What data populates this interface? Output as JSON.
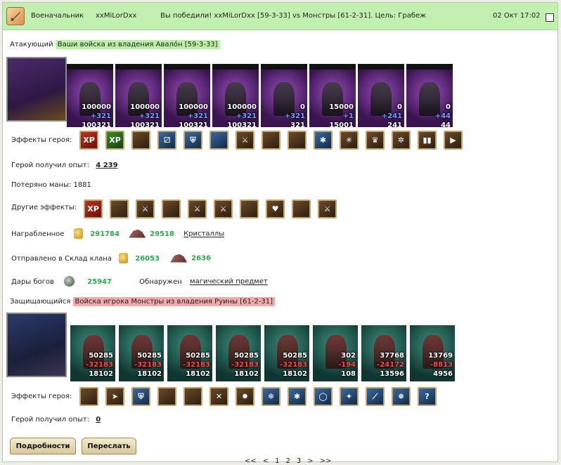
{
  "header": {
    "role": "Военачальник",
    "player": "xxMiLorDxx",
    "message": "Вы победили! xxMiLorDxx [59-3-33] vs Монстры [61-2-31]. Цель: Грабеж",
    "date": "02 Окт 17:02"
  },
  "attacker": {
    "label": "Атакующий",
    "army": "Ваши войска из владения Авалóн [59-3-33]",
    "units": [
      {
        "n1": "100000",
        "n2": "+321",
        "n3": "100321"
      },
      {
        "n1": "100000",
        "n2": "+321",
        "n3": "100321"
      },
      {
        "n1": "100000",
        "n2": "+321",
        "n3": "100321"
      },
      {
        "n1": "100000",
        "n2": "+321",
        "n3": "100321"
      },
      {
        "n1": "0",
        "n2": "+321",
        "n3": "321"
      },
      {
        "n1": "15000",
        "n2": "+1",
        "n3": "15001"
      },
      {
        "n1": "0",
        "n2": "+241",
        "n3": "241"
      },
      {
        "n1": "0",
        "n2": "+44",
        "n3": "44"
      }
    ]
  },
  "hero_effects_label": "Эффекты героя:",
  "attacker_hero_effects_icons": [
    "xp-icon",
    "xp-scroll-icon",
    "tome-icon",
    "dice-icon",
    "shield-icon",
    "hand-shield-icon",
    "sword-icon",
    "handshake-icon",
    "hand-icon",
    "ice-icon",
    "web-icon",
    "gold-idol-icon",
    "spider-icon",
    "boots-icon",
    "arrow-right-icon"
  ],
  "xp_gained": {
    "label": "Герой получил опыт:",
    "value": "4 239"
  },
  "mana_lost": "Потеряно маны: 1881",
  "other_effects": {
    "label": "Другие эффекты:",
    "icons": [
      "xp-icon",
      "scroll-icon",
      "sword-icon",
      "scroll-icon",
      "sword-icon",
      "sword-icon",
      "scroll-icon",
      "heart-icon",
      "scroll-icon",
      "sword-icon"
    ]
  },
  "plunder": {
    "label": "Награбленное",
    "gold": "291784",
    "crystals": "29518",
    "crystals_link": "Кристаллы"
  },
  "clan": {
    "label": "Отправлено в Склад клана",
    "gold": "26053",
    "crystals": "2636"
  },
  "gifts": {
    "label": "Дары богов",
    "value": "25947",
    "found_label": "Обнаружен",
    "found_link": "магический предмет"
  },
  "defender": {
    "label": "Защищающийся",
    "army": "Войска игрока Монстры из владения Руины [61-2-31]",
    "units": [
      {
        "n1": "50285",
        "n2": "-32183",
        "n3": "18102"
      },
      {
        "n1": "50285",
        "n2": "-32183",
        "n3": "18102"
      },
      {
        "n1": "50285",
        "n2": "-32183",
        "n3": "18102"
      },
      {
        "n1": "50285",
        "n2": "-32183",
        "n3": "18102"
      },
      {
        "n1": "50285",
        "n2": "-32183",
        "n3": "18102"
      },
      {
        "n1": "302",
        "n2": "-194",
        "n3": "108"
      },
      {
        "n1": "37768",
        "n2": "-24172",
        "n3": "13596"
      },
      {
        "n1": "13769",
        "n2": "-8813",
        "n3": "4956"
      }
    ]
  },
  "defender_hero_effects_icons": [
    "helmet-icon",
    "arrow-icon",
    "shield-icon",
    "fighter-icon",
    "door-icon",
    "crossed-swords-icon",
    "fire-icon",
    "snowflake-icon",
    "ice-icon",
    "ring-icon",
    "ice-shard-icon",
    "wand-icon",
    "frost-icon",
    "question-icon"
  ],
  "def_xp": {
    "label": "Герой получил опыт:",
    "value": "0"
  },
  "buttons": {
    "details": "Подробности",
    "forward": "Переслать"
  },
  "pager": [
    "<<",
    "<",
    "1",
    "2",
    "3",
    ">",
    ">>"
  ]
}
